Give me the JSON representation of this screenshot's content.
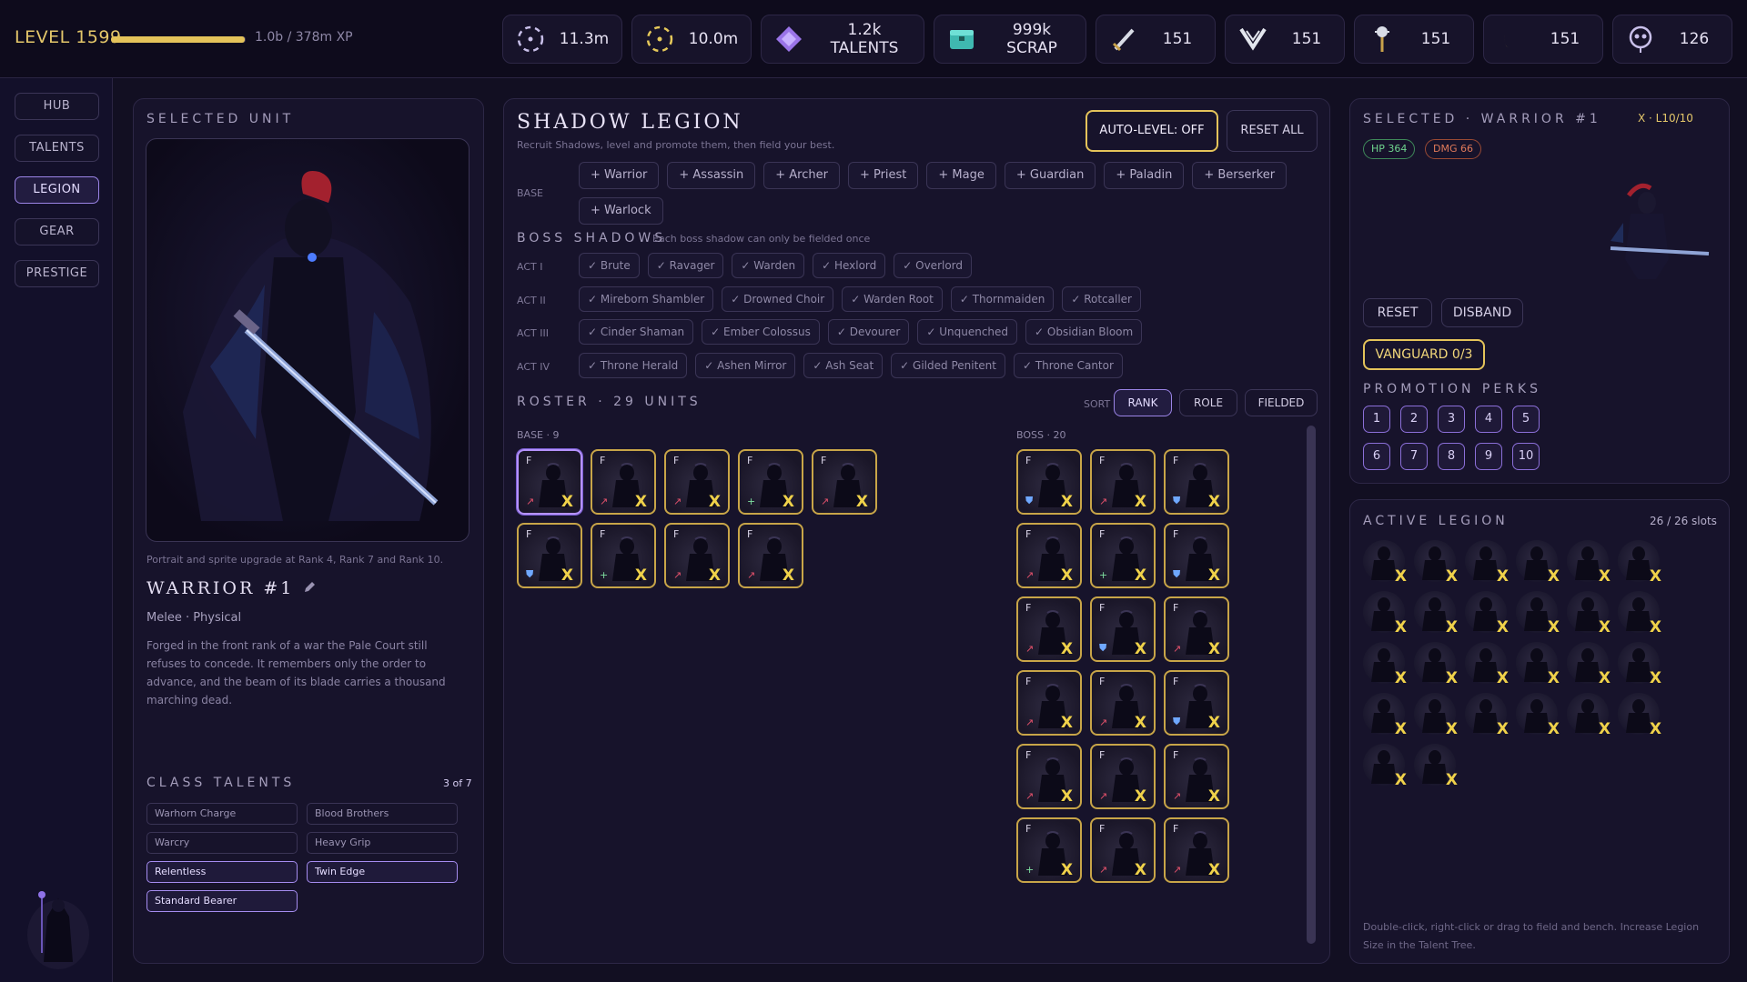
{
  "header": {
    "level_label": "LEVEL 1599",
    "xp_progress": 0.99,
    "xp_text": "1.0b / 378m XP",
    "resources": [
      {
        "icon": "essence-ring-icon",
        "value": "11.3m"
      },
      {
        "icon": "soul-ring-icon",
        "value": "10.0m"
      },
      {
        "icon": "talent-gem-icon",
        "value": "1.2k TALENTS"
      },
      {
        "icon": "scrap-chest-icon",
        "value": "999k SCRAP"
      },
      {
        "icon": "sword-icon",
        "value": "151"
      },
      {
        "icon": "horns-icon",
        "value": "151"
      },
      {
        "icon": "mace-icon",
        "value": "151"
      },
      {
        "icon": "crescent-icon",
        "value": "151"
      },
      {
        "icon": "skull-icon",
        "value": "126"
      }
    ]
  },
  "nav": {
    "items": [
      "HUB",
      "TALENTS",
      "LEGION",
      "GEAR",
      "PRESTIGE"
    ],
    "active": "LEGION"
  },
  "selected_unit": {
    "section_label": "SELECTED UNIT",
    "portrait_note": "Portrait and sprite upgrade at Rank 4, Rank 7 and Rank 10.",
    "name": "WARRIOR #1",
    "type": "Melee · Physical",
    "lore": "Forged in the front rank of a war the Pale Court still refuses to concede. It remembers only the order to advance, and the beam of its blade carries a thousand marching dead.",
    "talents_label": "CLASS TALENTS",
    "talents_count": "3 of 7",
    "talents": [
      {
        "name": "Warhorn Charge",
        "active": false
      },
      {
        "name": "Blood Brothers",
        "active": false
      },
      {
        "name": "Warcry",
        "active": false
      },
      {
        "name": "Heavy Grip",
        "active": false
      },
      {
        "name": "Relentless",
        "active": true
      },
      {
        "name": "Twin Edge",
        "active": true
      },
      {
        "name": "Standard Bearer",
        "active": true
      }
    ]
  },
  "legion": {
    "title": "SHADOW LEGION",
    "subtitle": "Recruit Shadows, level and promote them, then field your best.",
    "auto_level": "AUTO-LEVEL: OFF",
    "reset_all": "RESET ALL",
    "base_label": "BASE",
    "base_recruits": [
      "+ Warrior",
      "+ Assassin",
      "+ Archer",
      "+ Priest",
      "+ Mage",
      "+ Guardian",
      "+ Paladin",
      "+ Berserker",
      "+ Warlock"
    ],
    "boss_label": "BOSS SHADOWS",
    "boss_note": "Each boss shadow can only be fielded once",
    "acts": [
      {
        "label": "ACT I",
        "bosses": [
          "✓ Brute",
          "✓ Ravager",
          "✓ Warden",
          "✓ Hexlord",
          "✓ Overlord"
        ]
      },
      {
        "label": "ACT II",
        "bosses": [
          "✓ Mireborn Shambler",
          "✓ Drowned Choir",
          "✓ Warden Root",
          "✓ Thornmaiden",
          "✓ Rotcaller"
        ]
      },
      {
        "label": "ACT III",
        "bosses": [
          "✓ Cinder Shaman",
          "✓ Ember Colossus",
          "✓ Devourer",
          "✓ Unquenched",
          "✓ Obsidian Bloom"
        ]
      },
      {
        "label": "ACT IV",
        "bosses": [
          "✓ Throne Herald",
          "✓ Ashen Mirror",
          "✓ Ash Seat",
          "✓ Gilded Penitent",
          "✓ Throne Cantor"
        ]
      }
    ],
    "roster_label": "ROSTER · 29 UNITS",
    "sort_label": "SORT",
    "sort_options": [
      "RANK",
      "ROLE",
      "FIELDED"
    ],
    "sort_active": "RANK",
    "base_group_label": "BASE · 9",
    "boss_group_label": "BOSS · 20",
    "unit_badge": "F",
    "unit_mark": "X",
    "base_units": [
      "sword",
      "sword",
      "sword",
      "cross",
      "sword",
      "shield",
      "cross",
      "sword",
      "sword"
    ],
    "boss_units": [
      "shield",
      "sword",
      "shield",
      "sword",
      "cross",
      "shield",
      "sword",
      "shield",
      "sword",
      "sword",
      "sword",
      "shield",
      "sword",
      "sword",
      "sword",
      "cross",
      "sword",
      "sword",
      "cross",
      "cross"
    ]
  },
  "selected_detail": {
    "label": "SELECTED · WARRIOR #1",
    "rank": "X · L10/10",
    "hp": "HP 364",
    "dmg": "DMG 66",
    "reset": "RESET",
    "disband": "DISBAND",
    "vanguard": "VANGUARD 0/3",
    "perks_label": "PROMOTION PERKS",
    "perks": [
      "1",
      "2",
      "3",
      "4",
      "5",
      "6",
      "7",
      "8",
      "9",
      "10"
    ]
  },
  "active_legion": {
    "label": "ACTIVE LEGION",
    "slots": "26 / 26 slots",
    "count": 26,
    "mark": "X",
    "footer": "Double-click, right-click or drag to field and bench. Increase Legion Size in the Talent Tree."
  },
  "colors": {
    "gold": "#e4c76a",
    "accent": "#9b84e6",
    "hp": "#6fd58e",
    "dmg": "#e07a5a"
  }
}
